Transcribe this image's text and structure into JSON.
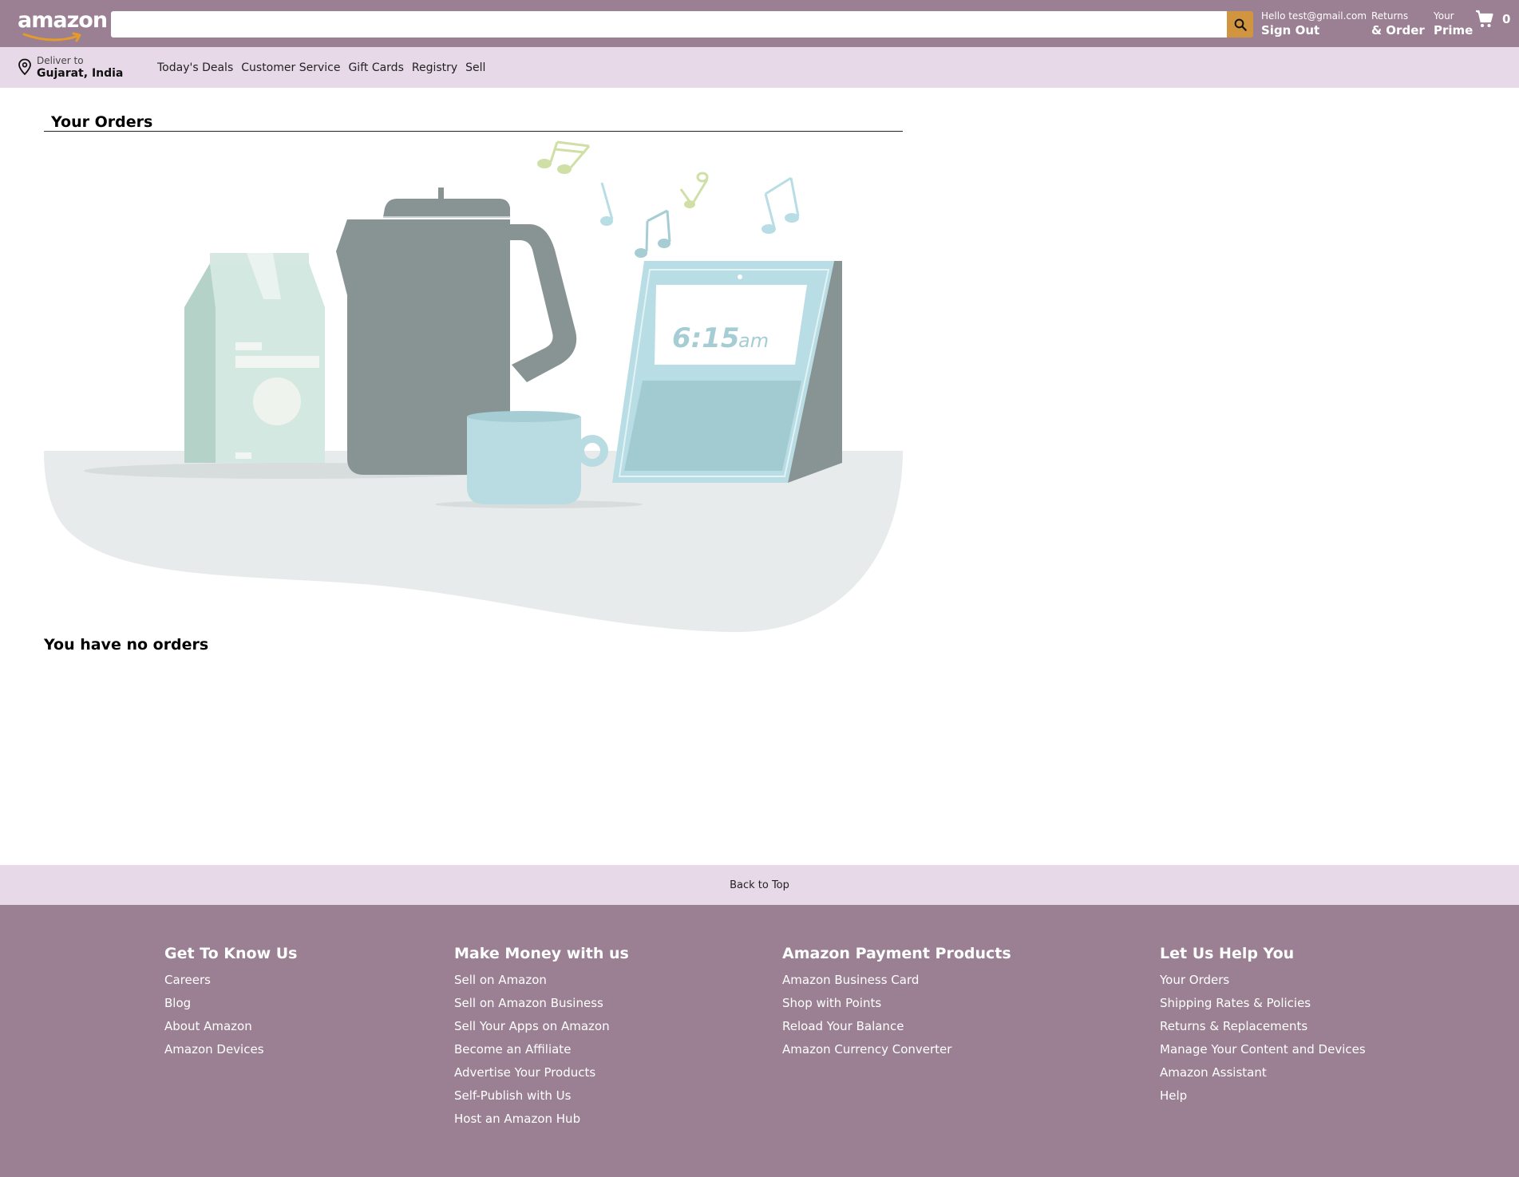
{
  "header": {
    "logo_text": "amazon",
    "search": {
      "value": "",
      "placeholder": ""
    },
    "account": {
      "greeting": "Hello test@gmail.com",
      "action": "Sign Out"
    },
    "returns": {
      "line1": "Returns",
      "line2": "& Order"
    },
    "prime": {
      "line1": "Your",
      "line2": "Prime"
    },
    "cart": {
      "count": "0"
    },
    "icons": {
      "search": "search-icon",
      "cart": "cart-icon",
      "location": "location-pin-icon"
    },
    "colors": {
      "bar": "#9a8092",
      "search_button": "#d0953e",
      "subnav": "#e7d9e8"
    }
  },
  "subnav": {
    "deliver_label": "Deliver to",
    "deliver_location": "Gujarat, India",
    "links": [
      "Today's Deals",
      "Customer Service",
      "Gift Cards",
      "Registry",
      "Sell"
    ]
  },
  "main": {
    "title": "Your Orders",
    "clock_time": "6:15",
    "clock_suffix": "am",
    "empty_message": "You have no orders"
  },
  "back_to_top": "Back to Top",
  "footer": {
    "columns": [
      {
        "title": "Get To Know Us",
        "links": [
          "Careers",
          "Blog",
          "About Amazon",
          "Amazon Devices"
        ]
      },
      {
        "title": "Make Money with us",
        "links": [
          "Sell on Amazon",
          "Sell on Amazon Business",
          "Sell Your Apps on Amazon",
          "Become an Affiliate",
          "Advertise Your Products",
          "Self-Publish with Us",
          "Host an Amazon Hub"
        ]
      },
      {
        "title": "Amazon Payment Products",
        "links": [
          "Amazon Business Card",
          "Shop with Points",
          "Reload Your Balance",
          "Amazon Currency Converter"
        ]
      },
      {
        "title": "Let Us Help You",
        "links": [
          "Your Orders",
          "Shipping Rates & Policies",
          "Returns & Replacements",
          "Manage Your Content and Devices",
          "Amazon Assistant",
          "Help"
        ]
      }
    ]
  }
}
